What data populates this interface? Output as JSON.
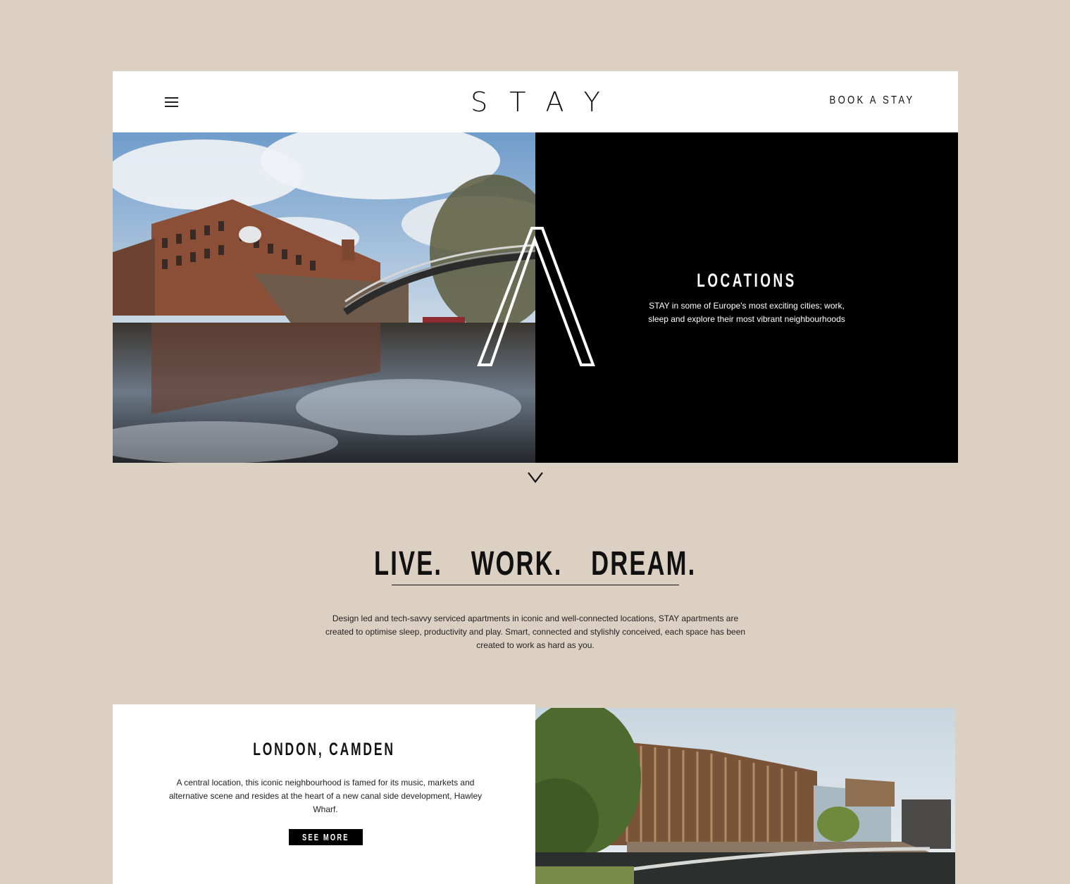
{
  "header": {
    "logo": "STAY",
    "book_label": "BOOK A STAY"
  },
  "hero": {
    "title": "LOCATIONS",
    "text": "STAY in some of Europe's most exciting cities; work, sleep and explore their most vibrant neighbourhoods"
  },
  "intro": {
    "title": "LIVE. WORK. DREAM.",
    "text": "Design led and tech-savvy serviced apartments in iconic and well-connected locations, STAY apartments are created to optimise sleep, productivity and play. Smart, connected and stylishly conceived, each space has been created to work as hard as you."
  },
  "location": {
    "title": "LONDON, CAMDEN",
    "text": "A central location, this iconic neighbourhood is famed for its music, markets and alternative scene and resides at the heart of a new canal side development, Hawley Wharf.",
    "button_label": "SEE MORE"
  },
  "colors": {
    "page_bg": "#dcd0c3",
    "panel": "#000000",
    "card": "#ffffff"
  },
  "icons": [
    "menu-icon",
    "a-logo-mark",
    "chevron-down-icon"
  ]
}
